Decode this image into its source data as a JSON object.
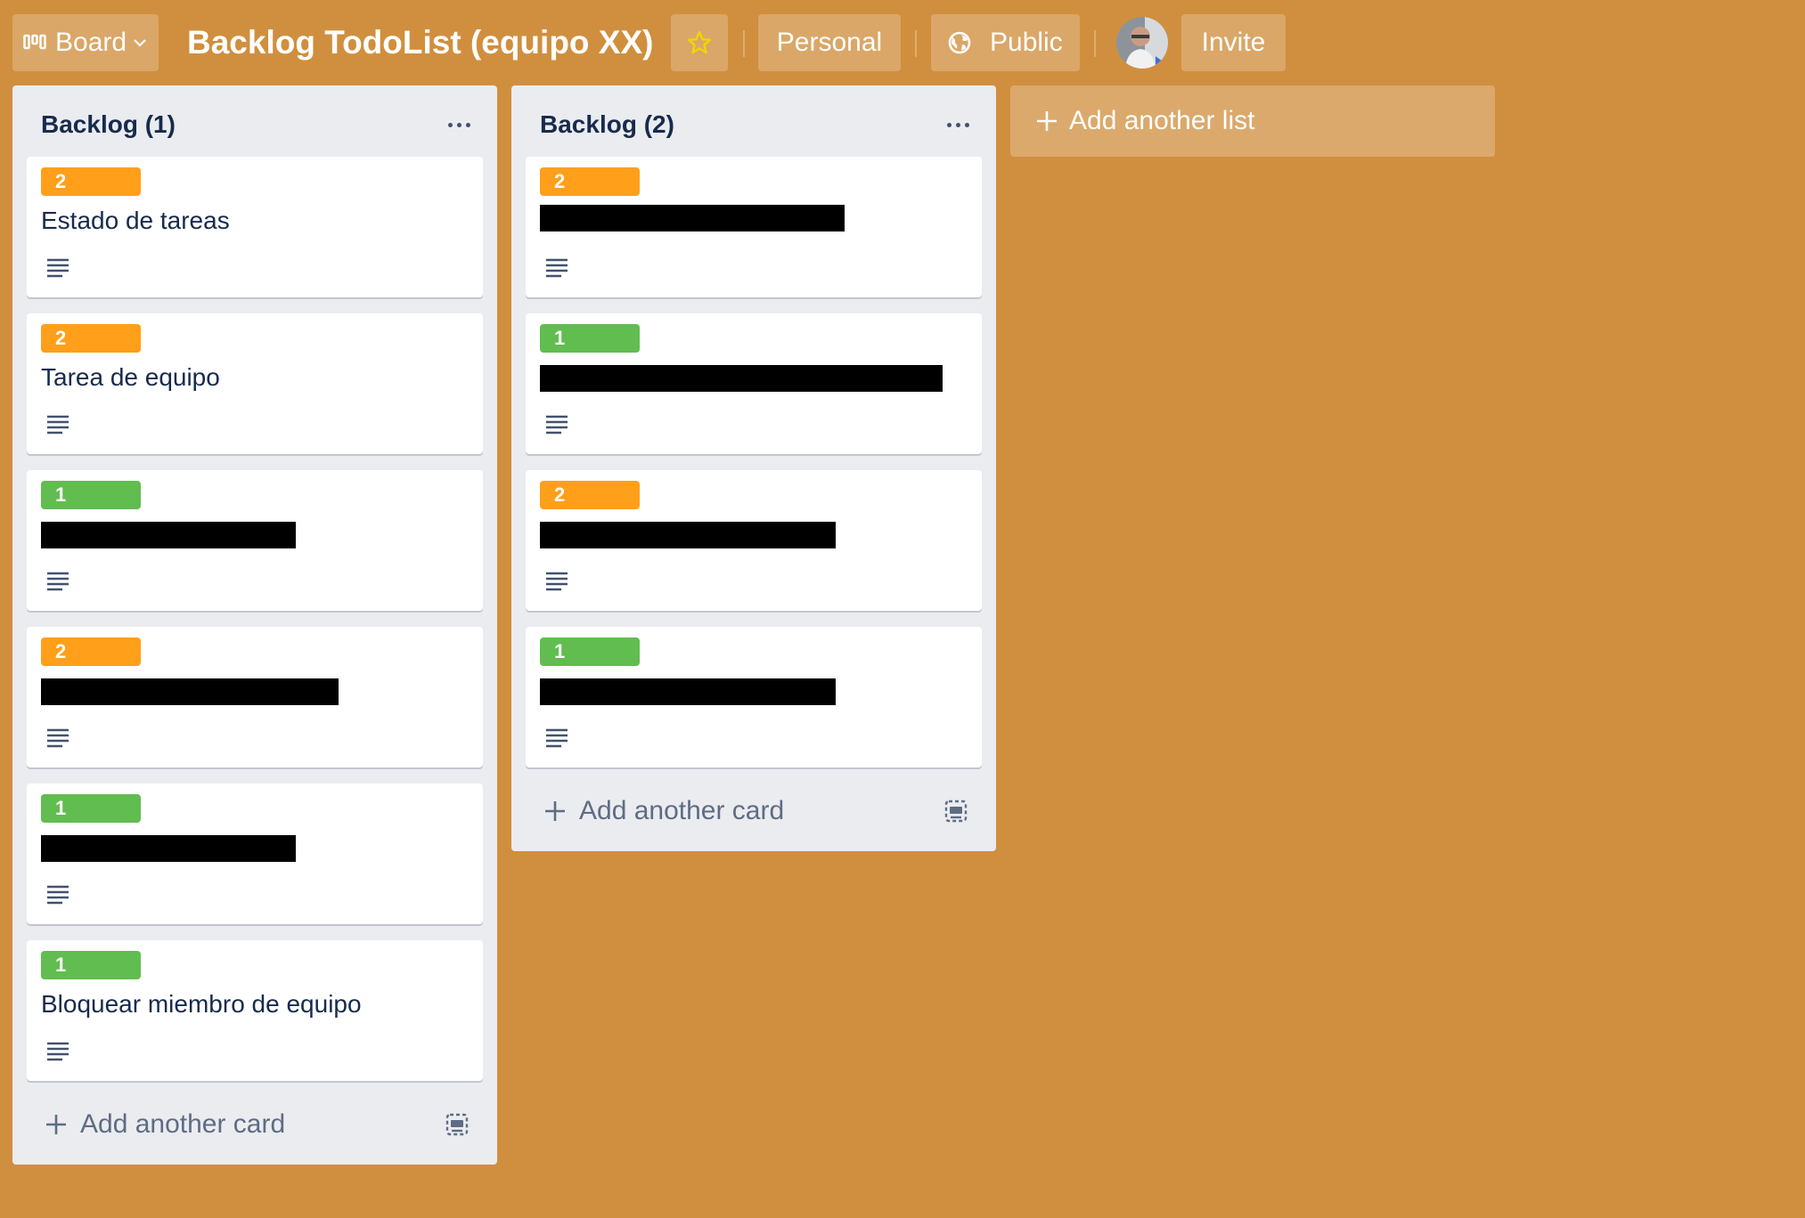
{
  "header": {
    "board_label": "Board",
    "title": "Backlog TodoList (equipo XX)",
    "personal_label": "Personal",
    "public_label": "Public",
    "invite_label": "Invite"
  },
  "colors": {
    "background": "#D08F3E",
    "badge_orange": "#FF9F1A",
    "badge_green": "#61BD4F",
    "star": "#F2D600"
  },
  "lists": [
    {
      "title": "Backlog (1)",
      "cards": [
        {
          "badge": "2",
          "title": "Estado de tareas"
        },
        {
          "badge": "2",
          "title": "Tarea de equipo"
        },
        {
          "badge": "1",
          "title": ""
        },
        {
          "badge": "2",
          "title": ""
        },
        {
          "badge": "1",
          "title": ""
        },
        {
          "badge": "1",
          "title": "Bloquear miembro de equipo"
        }
      ],
      "add_card_label": "Add another card"
    },
    {
      "title": "Backlog (2)",
      "cards": [
        {
          "badge": "2",
          "title": ""
        },
        {
          "badge": "1",
          "title": ""
        },
        {
          "badge": "2",
          "title": ""
        },
        {
          "badge": "1",
          "title": ""
        }
      ],
      "add_card_label": "Add another card"
    }
  ],
  "add_list_label": "Add another list"
}
